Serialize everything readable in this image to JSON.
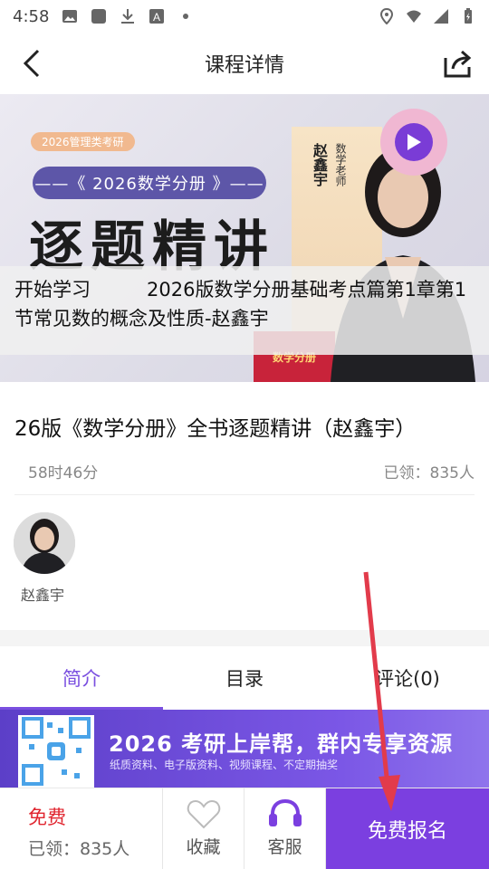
{
  "status_bar": {
    "time": "4:58"
  },
  "nav": {
    "title": "课程详情"
  },
  "banner": {
    "tag": "2026管理类考研",
    "subtitle": "——《 2026数学分册 》——",
    "headline": "逐题精讲",
    "teacher_name": "赵鑫宇",
    "teacher_role": "数学老师",
    "book_label": "数学分册",
    "overlay_start": "开始学习",
    "overlay_lesson": "2026版数学分册基础考点篇第1章第1节常见数的概念及性质-赵鑫宇"
  },
  "course": {
    "title": "26版《数学分册》全书逐题精讲（赵鑫宇）",
    "duration": "58时46分",
    "enrolled": "已领：835人"
  },
  "teacher": {
    "name": "赵鑫宇"
  },
  "tabs": [
    {
      "label": "简介",
      "active": true
    },
    {
      "label": "目录",
      "active": false
    },
    {
      "label": "评论(0)",
      "active": false
    }
  ],
  "promo": {
    "headline": "2026 考研上岸帮，群内专享资源",
    "sub": "纸质资料、电子版资料、视频课程、不定期抽奖"
  },
  "bottom": {
    "price": "免费",
    "count": "已领：835人",
    "favorite": "收藏",
    "service": "客服",
    "signup": "免费报名"
  },
  "colors": {
    "accent": "#7b3fe0",
    "price_red": "#e0242e",
    "annotation_arrow": "#e23b4b"
  }
}
